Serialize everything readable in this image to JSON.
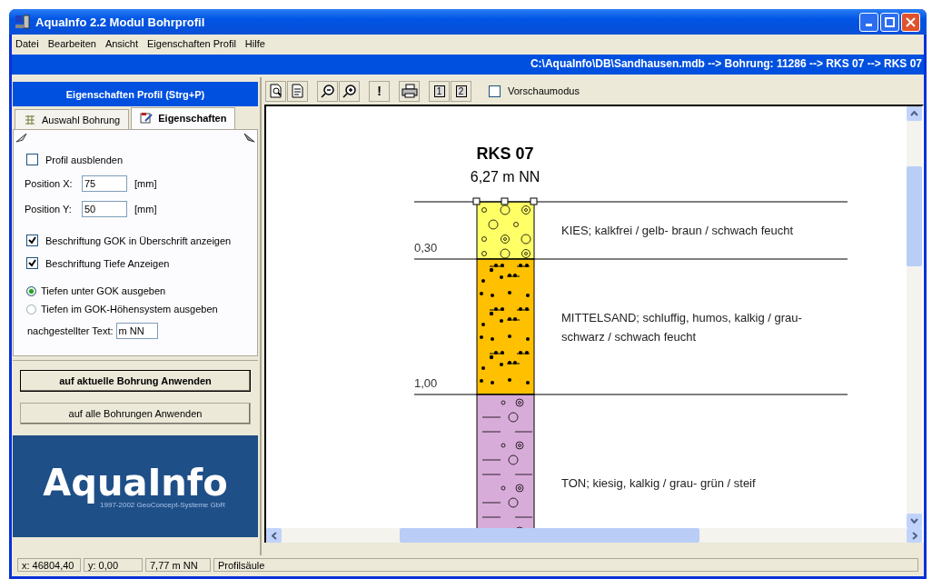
{
  "window": {
    "title": "AquaInfo 2.2  Modul Bohrprofil"
  },
  "menu": [
    "Datei",
    "Bearbeiten",
    "Ansicht",
    "Eigenschaften Profil",
    "Hilfe"
  ],
  "path_bar": "C:\\AquaInfo\\DB\\Sandhausen.mdb --> Bohrung: 11286 --> RKS 07 --> RKS 07",
  "panel": {
    "title": "Eigenschaften Profil (Strg+P)",
    "tabs": [
      {
        "label": "Auswahl Bohrung",
        "selected": false
      },
      {
        "label": "Eigenschaften",
        "selected": true
      }
    ],
    "hide_profile": {
      "label": "Profil ausblenden",
      "checked": false
    },
    "fields": [
      {
        "label": "Position X:",
        "value": "75",
        "unit": "[mm]"
      },
      {
        "label": "Position Y:",
        "value": "50",
        "unit": "[mm]"
      }
    ],
    "options": [
      {
        "label": "Beschriftung GOK in Überschrift anzeigen",
        "checked": true
      },
      {
        "label": "Beschriftung Tiefe Anzeigen",
        "checked": true
      }
    ],
    "radios": [
      {
        "label": "Tiefen unter GOK ausgeben",
        "selected": true
      },
      {
        "label": "Tiefen im GOK-Höhensystem ausgeben",
        "selected": false
      }
    ],
    "suffix": {
      "label": "nachgestellter Text:",
      "value": "m NN"
    },
    "buttons": [
      {
        "label": "auf aktuelle Bohrung Anwenden",
        "default": true
      },
      {
        "label": "auf alle Bohrungen Anwenden",
        "default": false
      }
    ],
    "logo": {
      "name": "AquaInfo",
      "caption": "1997-2002 GeoConcept-Systeme GbR"
    }
  },
  "toolbar": {
    "buttons": [
      {
        "kind": "preview"
      },
      {
        "kind": "page100"
      },
      {
        "kind": "zoom_out"
      },
      {
        "kind": "zoom_in"
      },
      {
        "kind": "text",
        "label": "!"
      },
      {
        "kind": "print"
      },
      {
        "kind": "text",
        "label": "1"
      },
      {
        "kind": "text",
        "label": "2"
      }
    ],
    "preview_mode": {
      "label": "Vorschaumodus",
      "checked": false
    }
  },
  "profile": {
    "title": "RKS 07",
    "elevation": "6,27 m NN",
    "layers": [
      {
        "kind": "gravel",
        "color": "#ffff66",
        "depth_label": "0,30",
        "description": "KIES; kalkfrei / gelb- braun / schwach feucht"
      },
      {
        "kind": "sand",
        "color": "#ffc000",
        "depth_label": "1,00",
        "description": "MITTELSAND; schluffig, humos, kalkig / grau- schwarz / schwach feucht"
      },
      {
        "kind": "clay",
        "color": "#d8acd8",
        "description": "TON; kiesig, kalkig / grau- grün / steif"
      }
    ]
  },
  "status_bar": [
    "x: 46804,40",
    "y: 0,00",
    "7,77 m NN",
    "Profilsäule"
  ]
}
